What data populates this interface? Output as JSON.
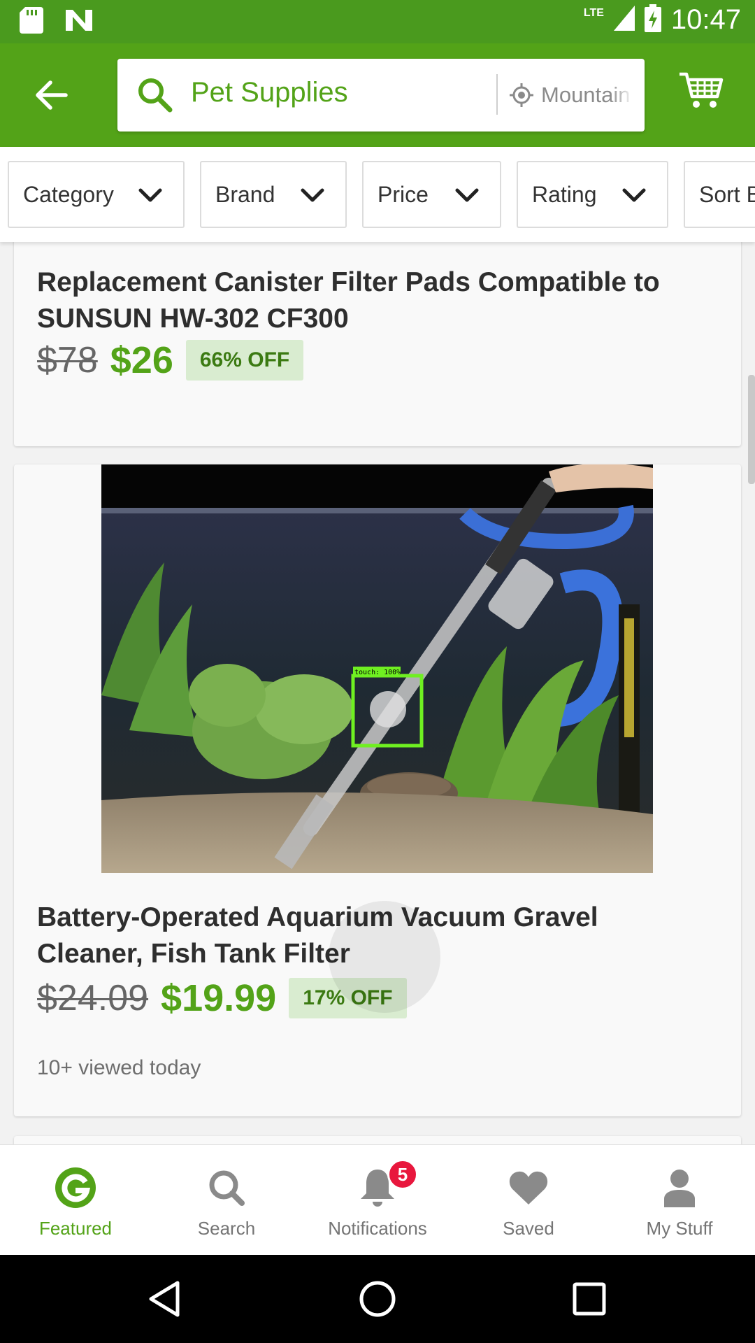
{
  "status_bar": {
    "time": "10:47",
    "network": "LTE",
    "icons": [
      "sd-card-icon",
      "n-notification-icon",
      "signal-icon",
      "battery-charging-icon"
    ]
  },
  "header": {
    "search_text": "Pet Supplies",
    "location_text": "Mountain View",
    "icons": [
      "back-arrow-icon",
      "search-icon",
      "location-icon",
      "cart-icon"
    ],
    "brand_color": "#53a318"
  },
  "filters": [
    {
      "label": "Category"
    },
    {
      "label": "Brand"
    },
    {
      "label": "Price"
    },
    {
      "label": "Rating"
    },
    {
      "label": "Sort By"
    }
  ],
  "products": [
    {
      "title": "Replacement Canister Filter Pads Compatible to SUNSUN HW-302 CF300",
      "old_price": "$78",
      "new_price": "$26",
      "discount": "66% OFF"
    },
    {
      "title": "Battery-Operated Aquarium Vacuum Gravel Cleaner, Fish Tank Filter",
      "old_price": "$24.09",
      "new_price": "$19.99",
      "discount": "17% OFF",
      "viewed": "10+ viewed today",
      "image_overlay_label": "touch: 100%"
    }
  ],
  "bottom_nav": {
    "items": [
      {
        "label": "Featured",
        "icon": "groupon-g-icon",
        "active": true
      },
      {
        "label": "Search",
        "icon": "search-icon",
        "active": false
      },
      {
        "label": "Notifications",
        "icon": "bell-icon",
        "active": false,
        "badge": "5"
      },
      {
        "label": "Saved",
        "icon": "heart-icon",
        "active": false
      },
      {
        "label": "My Stuff",
        "icon": "person-icon",
        "active": false
      }
    ]
  },
  "system_nav": {
    "icons": [
      "back-triangle-icon",
      "home-circle-icon",
      "recents-square-icon"
    ]
  }
}
